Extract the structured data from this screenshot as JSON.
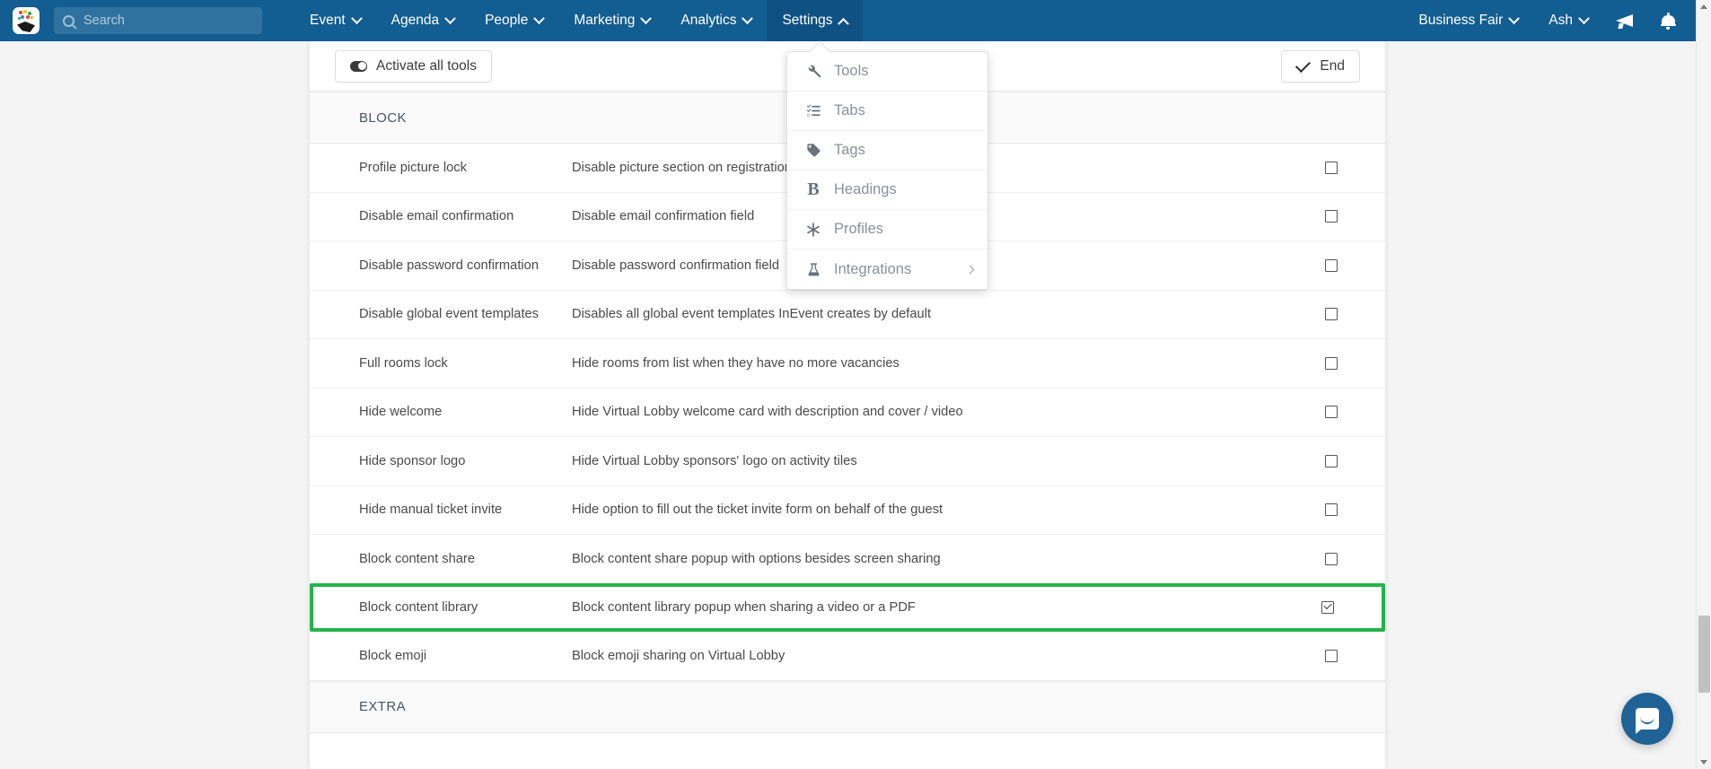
{
  "navbar": {
    "logo_name": "inevent-logo",
    "search": {
      "placeholder": "Search",
      "value": ""
    },
    "menu": [
      {
        "label": "Event",
        "caret": "down",
        "active": false
      },
      {
        "label": "Agenda",
        "caret": "down",
        "active": false
      },
      {
        "label": "People",
        "caret": "down",
        "active": false
      },
      {
        "label": "Marketing",
        "caret": "down",
        "active": false
      },
      {
        "label": "Analytics",
        "caret": "down",
        "active": false
      },
      {
        "label": "Settings",
        "caret": "up",
        "active": true
      }
    ],
    "right": [
      {
        "label": "Business Fair",
        "caret": "down"
      },
      {
        "label": "Ash",
        "caret": "down"
      }
    ],
    "icons": [
      "megaphone-icon",
      "bell-icon"
    ],
    "background_color": "#125D91",
    "active_item_color": "#0F5182"
  },
  "dropdown": {
    "open_for": "Settings",
    "items": [
      {
        "label": "Tools",
        "icon": "wrench-icon",
        "has_submenu": false
      },
      {
        "label": "Tabs",
        "icon": "list-icon",
        "has_submenu": false
      },
      {
        "label": "Tags",
        "icon": "tag-icon",
        "has_submenu": false
      },
      {
        "label": "Headings",
        "icon": "bold-b-icon",
        "has_submenu": false
      },
      {
        "label": "Profiles",
        "icon": "asterisk-icon",
        "has_submenu": false
      },
      {
        "label": "Integrations",
        "icon": "flask-icon",
        "has_submenu": true
      }
    ]
  },
  "toolbar": {
    "activate_all_label": "Activate all tools",
    "end_label": "End"
  },
  "sections": [
    {
      "title": "BLOCK",
      "rows": [
        {
          "name": "Profile picture lock",
          "desc": "Disable picture section on registration form",
          "checked": false,
          "highlighted": false
        },
        {
          "name": "Disable email confirmation",
          "desc": "Disable email confirmation field",
          "checked": false,
          "highlighted": false
        },
        {
          "name": "Disable password confirmation",
          "desc": "Disable password confirmation field",
          "checked": false,
          "highlighted": false
        },
        {
          "name": "Disable global event templates",
          "desc": "Disables all global event templates InEvent creates by default",
          "checked": false,
          "highlighted": false
        },
        {
          "name": "Full rooms lock",
          "desc": "Hide rooms from list when they have no more vacancies",
          "checked": false,
          "highlighted": false
        },
        {
          "name": "Hide welcome",
          "desc": "Hide Virtual Lobby welcome card with description and cover / video",
          "checked": false,
          "highlighted": false
        },
        {
          "name": "Hide sponsor logo",
          "desc": "Hide Virtual Lobby sponsors' logo on activity tiles",
          "checked": false,
          "highlighted": false
        },
        {
          "name": "Hide manual ticket invite",
          "desc": "Hide option to fill out the ticket invite form on behalf of the guest",
          "checked": false,
          "highlighted": false
        },
        {
          "name": "Block content share",
          "desc": "Block content share popup with options besides screen sharing",
          "checked": false,
          "highlighted": false
        },
        {
          "name": "Block content library",
          "desc": "Block content library popup when sharing a video or a PDF",
          "checked": true,
          "highlighted": true
        },
        {
          "name": "Block emoji",
          "desc": "Block emoji sharing on Virtual Lobby",
          "checked": false,
          "highlighted": false
        }
      ]
    },
    {
      "title": "EXTRA",
      "rows": []
    }
  ],
  "chat": {
    "name": "intercom-chat-launcher",
    "color": "#1F6296"
  },
  "highlight_color": "#24B34B"
}
